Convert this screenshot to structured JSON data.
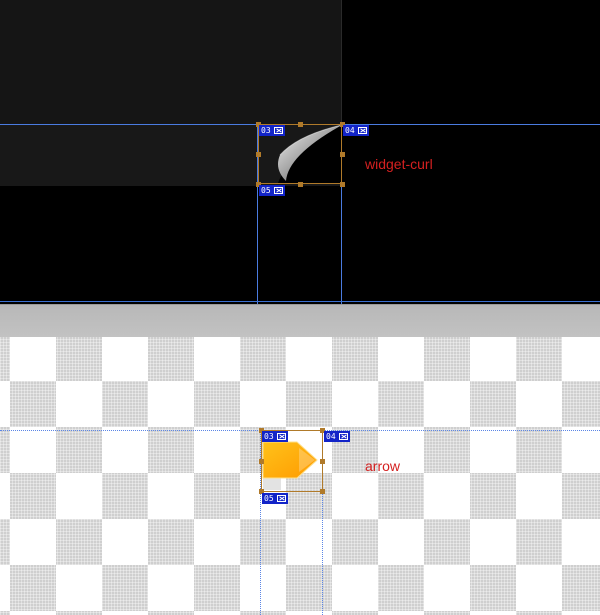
{
  "slices": [
    {
      "id": "widget-curl",
      "label": "widget-curl",
      "tags": {
        "top_left": "03",
        "top_right": "04",
        "bottom_left": "05"
      }
    },
    {
      "id": "arrow",
      "label": "arrow",
      "tags": {
        "top_left": "03",
        "top_right": "04",
        "bottom_left": "05"
      }
    }
  ],
  "colors": {
    "label_red": "#d42020",
    "guide_blue": "#4a7be0",
    "slice_tag_blue": "#1224c8",
    "selection_bronze": "#b07a2a",
    "arrow_orange": "#ffb000"
  },
  "icons": {
    "tag_icon": "slice-tag-icon",
    "curl_graphic": "page-curl-icon",
    "arrow_graphic": "arrow-right-icon"
  }
}
